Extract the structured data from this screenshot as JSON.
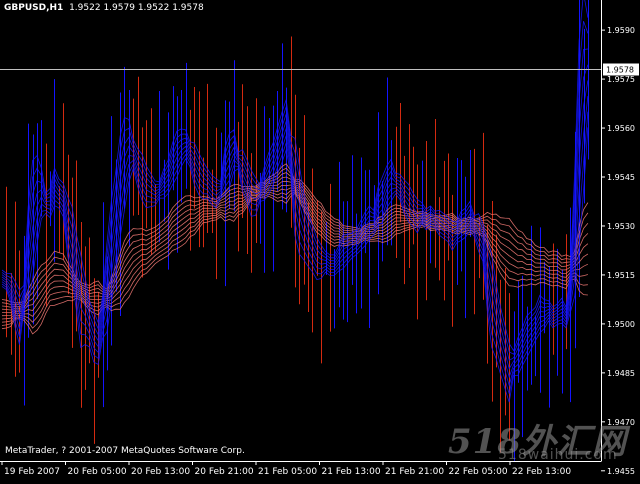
{
  "header": {
    "symbol": "GBPUSD,H1",
    "open": "1.9522",
    "high": "1.9579",
    "low": "1.9522",
    "close": "1.9578"
  },
  "copyright": "MetaTrader, ? 2001-2007 MetaQuotes Software Corp.",
  "watermark": {
    "main": "518外汇网",
    "sub": "518waihui.com"
  },
  "colors": {
    "background": "#000000",
    "axis": "#ffffff",
    "ma_fast": "#1414ff",
    "ma_slow": "#e87470",
    "bar_up": "#1414ff",
    "bar_down": "#d42a10",
    "price_line": "#c0c0c0"
  },
  "chart_data": {
    "type": "line",
    "title": "GBPUSD,H1",
    "ylim": [
      1.9458,
      1.9598
    ],
    "y_ticks": [
      "1.9590",
      "1.9575",
      "1.9560",
      "1.9545",
      "1.9530",
      "1.9515",
      "1.9500",
      "1.9485",
      "1.9470",
      "1.9455"
    ],
    "current_price": "1.9578",
    "x_labels": [
      "19 Feb 2007",
      "20 Feb 05:00",
      "20 Feb 13:00",
      "20 Feb 21:00",
      "21 Feb 05:00",
      "21 Feb 13:00",
      "21 Feb 21:00",
      "22 Feb 05:00",
      "22 Feb 13:00"
    ],
    "x": [
      0,
      4,
      8,
      12,
      16,
      20,
      24,
      28,
      32,
      36,
      40,
      44,
      48,
      52,
      56,
      60,
      64,
      68,
      72,
      76,
      80,
      84,
      88,
      92,
      96,
      100,
      104,
      108,
      112,
      116,
      120,
      124,
      128,
      132,
      136,
      140,
      144,
      148,
      152,
      156,
      160,
      164,
      168,
      172,
      176,
      180,
      184,
      188,
      192,
      196,
      200,
      204,
      208,
      212,
      216,
      220,
      224,
      228,
      232,
      236,
      240,
      244,
      248,
      252,
      256,
      260,
      264,
      268,
      272,
      276,
      280,
      284,
      288,
      292,
      296,
      300,
      304,
      308,
      312,
      316,
      320,
      324,
      328,
      332,
      336,
      340,
      344,
      348,
      352,
      356,
      360,
      364,
      368,
      372,
      376,
      380,
      384,
      388,
      392,
      396,
      400,
      404,
      408,
      412,
      416,
      420,
      424,
      428,
      432,
      436,
      440,
      444,
      448,
      452,
      456,
      460,
      464,
      468,
      472,
      476,
      480,
      484,
      488,
      492,
      496,
      500,
      504,
      508,
      512,
      516,
      520,
      524,
      528,
      532,
      536
    ],
    "series": [
      {
        "values": [
          1.9514,
          1.9513,
          1.9511,
          1.9506,
          1.9502,
          1.9508,
          1.9521,
          1.9532,
          1.9538,
          1.954,
          1.9537,
          1.9537,
          1.9542,
          1.954,
          1.9538,
          1.953,
          1.9525,
          1.9516,
          1.9507,
          1.9504,
          1.95,
          1.9496,
          1.9494,
          1.9502,
          1.9511,
          1.9522,
          1.9531,
          1.9542,
          1.9549,
          1.9553,
          1.9552,
          1.9548,
          1.9545,
          1.9542,
          1.9541,
          1.954,
          1.9541,
          1.9543,
          1.9545,
          1.9549,
          1.9552,
          1.9554,
          1.9555,
          1.9552,
          1.9549,
          1.9546,
          1.9544,
          1.9543,
          1.9541,
          1.954,
          1.9541,
          1.9547,
          1.955,
          1.9553,
          1.955,
          1.9547,
          1.9544,
          1.954,
          1.9539,
          1.954,
          1.9543,
          1.9546,
          1.9549,
          1.9553,
          1.9557,
          1.9561,
          1.9552,
          1.9542,
          1.9535,
          1.953,
          1.9526,
          1.9523,
          1.952,
          1.9519,
          1.9519,
          1.9518,
          1.9518,
          1.952,
          1.9522,
          1.9523,
          1.9524,
          1.9525,
          1.9527,
          1.9529,
          1.9531,
          1.9531,
          1.9536,
          1.9538,
          1.9542,
          1.9544,
          1.9543,
          1.9542,
          1.9539,
          1.9537,
          1.9535,
          1.9533,
          1.9534,
          1.9532,
          1.9533,
          1.9532,
          1.9531,
          1.953,
          1.9529,
          1.9527,
          1.9528,
          1.953,
          1.9531,
          1.9533,
          1.953,
          1.9528,
          1.9525,
          1.9515,
          1.9507,
          1.9501,
          1.9495,
          1.949,
          1.9485,
          1.9488,
          1.949,
          1.9493,
          1.9496,
          1.9498,
          1.95,
          1.9503,
          1.9503,
          1.9504,
          1.9502,
          1.9503,
          1.9504,
          1.9502,
          1.951,
          1.9528,
          1.9555,
          1.9571,
          1.9577
        ]
      },
      {
        "values": [
          1.9503,
          1.9503,
          1.9503,
          1.9504,
          1.9504,
          1.9504,
          1.9505,
          1.9505,
          1.9507,
          1.9509,
          1.9511,
          1.9513,
          1.9514,
          1.9514,
          1.9514,
          1.9513,
          1.9512,
          1.9511,
          1.951,
          1.9509,
          1.9508,
          1.9508,
          1.9508,
          1.9508,
          1.9508,
          1.9509,
          1.9511,
          1.9513,
          1.9516,
          1.9518,
          1.952,
          1.9521,
          1.9522,
          1.9522,
          1.9523,
          1.9524,
          1.9525,
          1.9526,
          1.9527,
          1.9529,
          1.953,
          1.9531,
          1.9532,
          1.9533,
          1.9533,
          1.9534,
          1.9535,
          1.9535,
          1.9535,
          1.9535,
          1.9536,
          1.9536,
          1.9537,
          1.9537,
          1.9538,
          1.9538,
          1.9539,
          1.954,
          1.954,
          1.9541,
          1.9541,
          1.9542,
          1.9542,
          1.9542,
          1.9543,
          1.9543,
          1.9543,
          1.9542,
          1.9541,
          1.9539,
          1.9537,
          1.9535,
          1.9533,
          1.9532,
          1.953,
          1.9529,
          1.9528,
          1.9528,
          1.9527,
          1.9527,
          1.9527,
          1.9527,
          1.9527,
          1.9528,
          1.9528,
          1.9528,
          1.9529,
          1.9529,
          1.953,
          1.9531,
          1.9532,
          1.9532,
          1.9532,
          1.9532,
          1.9532,
          1.9532,
          1.9532,
          1.9532,
          1.9531,
          1.9531,
          1.9531,
          1.9531,
          1.9531,
          1.9531,
          1.953,
          1.953,
          1.953,
          1.953,
          1.953,
          1.953,
          1.953,
          1.9529,
          1.9527,
          1.9526,
          1.9524,
          1.9523,
          1.9522,
          1.9521,
          1.952,
          1.952,
          1.9519,
          1.9519,
          1.9518,
          1.9518,
          1.9518,
          1.9517,
          1.9517,
          1.9517,
          1.9516,
          1.9516,
          1.9517,
          1.9518,
          1.952,
          1.9522,
          1.9523
        ]
      }
    ]
  }
}
